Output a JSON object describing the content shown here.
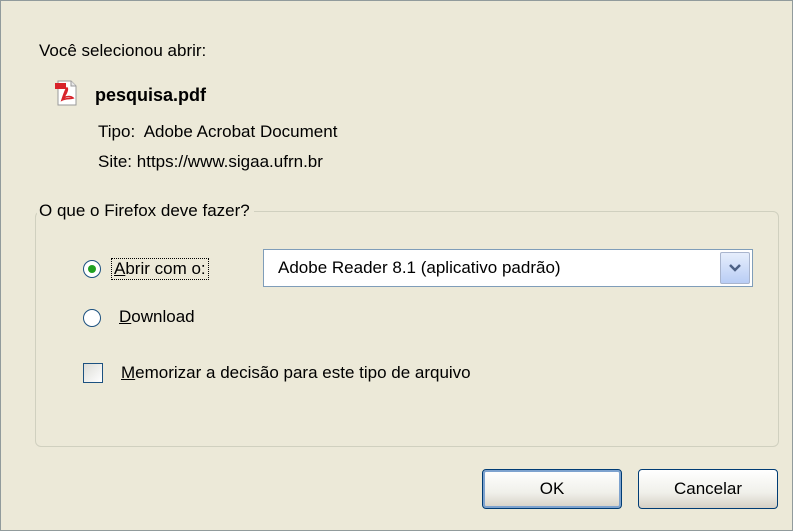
{
  "intro_text": "Você selecionou abrir:",
  "file": {
    "name": "pesquisa.pdf",
    "type_label": "Tipo:",
    "type_value": "Adobe Acrobat Document",
    "site_label": "Site:",
    "site_value": "https://www.sigaa.ufrn.br",
    "icon": "pdf-file-icon"
  },
  "group": {
    "legend": "O que o Firefox deve fazer?",
    "open_with": {
      "mnemonic": "A",
      "label_rest": "brir com o:",
      "selected": true
    },
    "application_select": {
      "value": "Adobe Reader 8.1 (aplicativo padrão)"
    },
    "download": {
      "mnemonic": "D",
      "label_rest": "ownload",
      "selected": false
    },
    "remember": {
      "mnemonic": "M",
      "label_rest": "emorizar a decisão para este tipo de arquivo",
      "checked": false
    }
  },
  "buttons": {
    "ok": "OK",
    "cancel": "Cancelar"
  },
  "colors": {
    "dialog_bg": "#ECE9D8",
    "radio_dot": "#21A121",
    "pdf_red": "#D8232A"
  }
}
